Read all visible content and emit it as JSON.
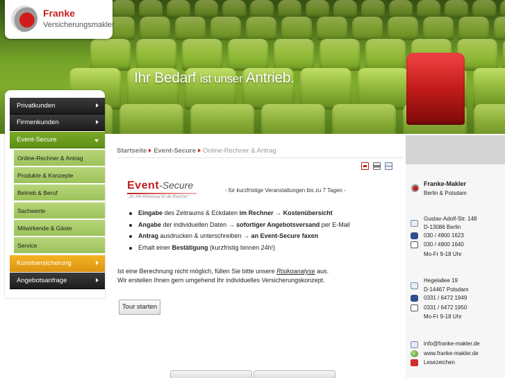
{
  "brand": {
    "name": "Franke",
    "subtitle": "Versicherungsmakler"
  },
  "banner": {
    "slogan_big_1": "Ihr Bedarf",
    "slogan_small": "ist unser",
    "slogan_big_2": "Antrieb."
  },
  "nav": {
    "items": [
      {
        "label": "Privatkunden"
      },
      {
        "label": "Firmenkunden"
      },
      {
        "label": "Event-Secure"
      },
      {
        "label": "Kunstversicherung"
      },
      {
        "label": "Angebotsanfrage"
      }
    ],
    "sub_items": [
      {
        "label": "Online-Rechner & Antrag"
      },
      {
        "label": "Produkte & Konzepte"
      },
      {
        "label": "Betrieb & Beruf"
      },
      {
        "label": "Sachwerte"
      },
      {
        "label": "Mitwirkende & Gäste"
      },
      {
        "label": "Service"
      }
    ]
  },
  "breadcrumb": {
    "items": [
      "Startseite",
      "Event-Secure"
    ],
    "current": "Online-Rechner & Antrag"
  },
  "event_secure": {
    "logo_event": "Event",
    "logo_secure": "-Secure",
    "logo_tagline": "„Ihr 24h-Werkzeug für die Branche\"",
    "note": "- für kurzfristige Veranstaltungen bis zu 7 Tagen -"
  },
  "bullets": [
    {
      "b1": "Eingabe",
      "t1": " des Zeitraums & Eckdaten ",
      "b2": "im Rechner",
      "t2": " → ",
      "b3": "Kostenübersicht",
      "t3": ""
    },
    {
      "b1": "Angabe",
      "t1": " der individuellen Daten → ",
      "b2": "sofortiger Angebotsversand",
      "t2": " per E-Mail",
      "b3": "",
      "t3": ""
    },
    {
      "b1": "Antrag",
      "t1": " ausdrucken & unterschreiben → ",
      "b2": "an Event-Secure faxen",
      "t2": "",
      "b3": "",
      "t3": ""
    },
    {
      "b1": "",
      "t1": "Erhalt einer ",
      "b2": "Bestätigung",
      "t2": " (kurzfristig binnen 24h!)",
      "b3": "",
      "t3": ""
    }
  ],
  "paragraph": {
    "line1_before": "Ist eine Berechnung nicht möglich, füllen Sie bitte unsere ",
    "link": "Risikoanalyse",
    "line1_after": " aus.",
    "line2": "Wir erstellen Ihnen gern umgehend Ihr individuelles Versicherungskonzept."
  },
  "tour_button": "Tour starten",
  "contact": {
    "company": "Franke-Makler",
    "locations": "Berlin & Potsdam",
    "office1": {
      "street": "Gustav-Adolf-Str. 148",
      "city": "D-13086 Berlin",
      "phone": "030 / 4900 1623",
      "fax": "030 / 4900 1640",
      "hours": "Mo-Fr 9-18 Uhr"
    },
    "office2": {
      "street": "Hegelallee 19",
      "city": "D-14467 Potsdam",
      "phone": "0331 / 6472 1949",
      "fax": "0331 / 6472 1950",
      "hours": "Mo-Fr 9-18 Uhr"
    },
    "email": "info@franke-makler.de",
    "web": "www.franke-makler.de",
    "bookmark": "Lesezeichen"
  },
  "colors": {
    "brand_red": "#cc1f1f",
    "nav_dark": "#1d1d1d",
    "nav_green": "#6a9a1f",
    "nav_orange": "#ef9f14",
    "sub_green": "#a6c966"
  }
}
